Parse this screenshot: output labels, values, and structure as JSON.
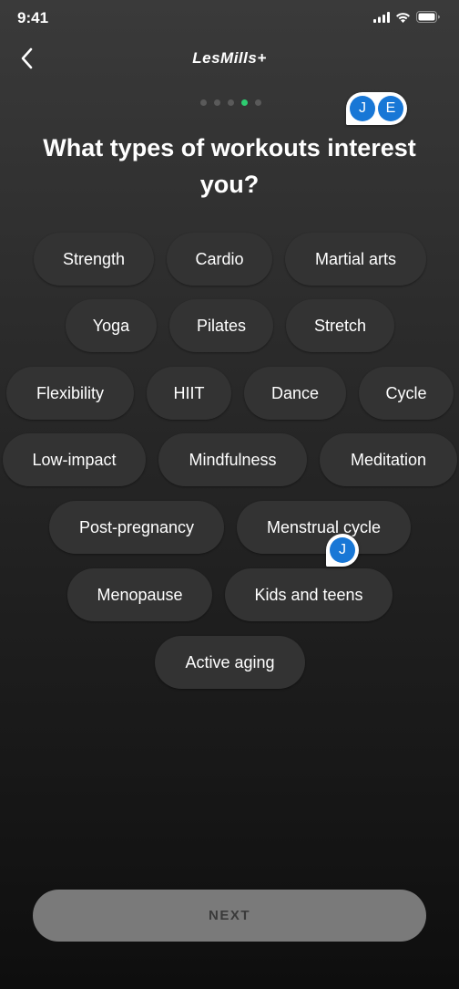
{
  "status": {
    "time": "9:41"
  },
  "header": {
    "brand": "LesMills+"
  },
  "progress": {
    "total_steps": 5,
    "current_step": 4,
    "active_color": "#2ecc71"
  },
  "question": {
    "title": "What types of workouts interest you?"
  },
  "options": [
    "Strength",
    "Cardio",
    "Martial arts",
    "Yoga",
    "Pilates",
    "Stretch",
    "Flexibility",
    "HIIT",
    "Dance",
    "Cycle",
    "Low-impact",
    "Mindfulness",
    "Meditation",
    "Post-pregnancy",
    "Menstrual cycle",
    "Menopause",
    "Kids and teens",
    "Active aging"
  ],
  "presence": {
    "header_avatars": [
      "J",
      "E"
    ],
    "option_avatar": "J",
    "avatar_color": "#1877d6"
  },
  "footer": {
    "next_label": "NEXT"
  }
}
